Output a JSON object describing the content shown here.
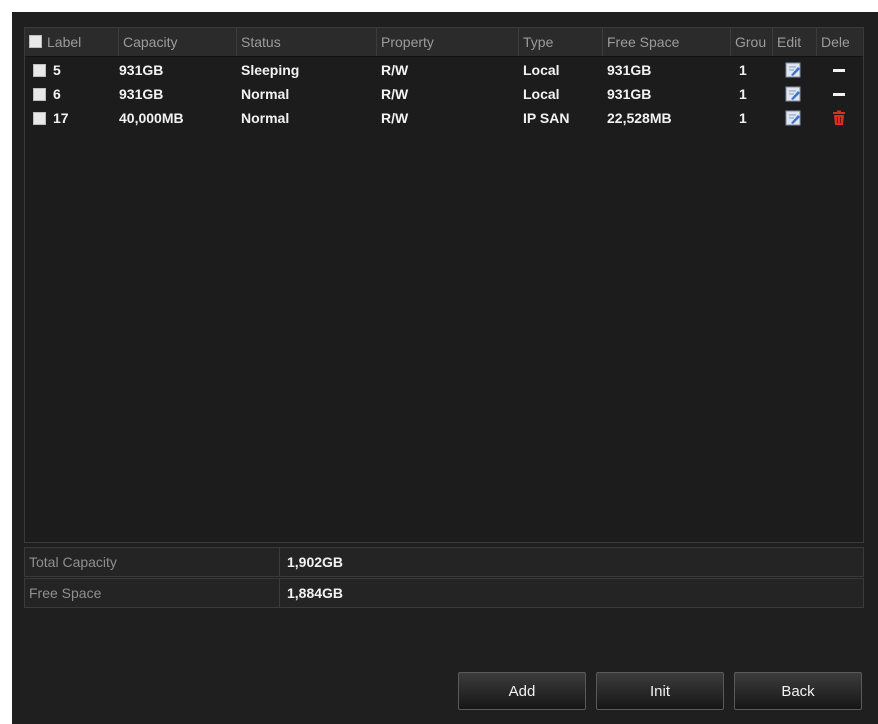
{
  "table": {
    "headers": {
      "label": "Label",
      "capacity": "Capacity",
      "status": "Status",
      "property": "Property",
      "type": "Type",
      "free_space": "Free Space",
      "group": "Grou",
      "edit": "Edit",
      "delete": "Dele"
    },
    "rows": [
      {
        "label": "5",
        "capacity": "931GB",
        "status": "Sleeping",
        "property": "R/W",
        "type": "Local",
        "free_space": "931GB",
        "group": "1",
        "delete_icon": "dash-icon"
      },
      {
        "label": "6",
        "capacity": "931GB",
        "status": "Normal",
        "property": "R/W",
        "type": "Local",
        "free_space": "931GB",
        "group": "1",
        "delete_icon": "dash-icon"
      },
      {
        "label": "17",
        "capacity": "40,000MB",
        "status": "Normal",
        "property": "R/W",
        "type": "IP SAN",
        "free_space": "22,528MB",
        "group": "1",
        "delete_icon": "trash-icon"
      }
    ]
  },
  "summary": {
    "total_capacity_label": "Total Capacity",
    "total_capacity_value": "1,902GB",
    "free_space_label": "Free Space",
    "free_space_value": "1,884GB"
  },
  "buttons": {
    "add": "Add",
    "init": "Init",
    "back": "Back"
  },
  "colors": {
    "background": "#1f1f1f",
    "delete_accent": "#d8301c"
  }
}
